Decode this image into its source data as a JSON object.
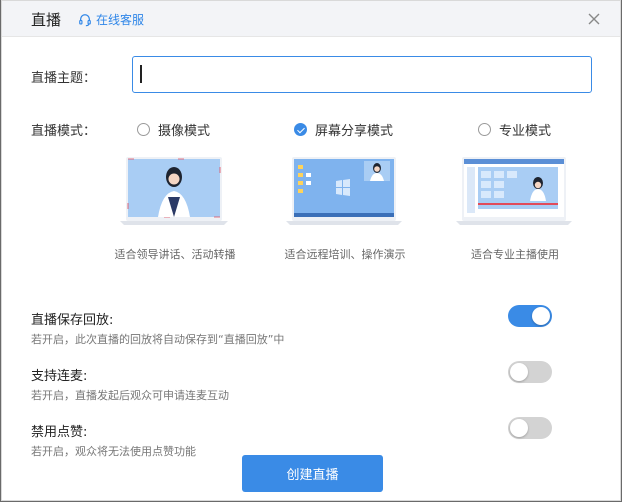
{
  "header": {
    "title": "直播",
    "support_label": "在线客服",
    "close_icon": "close-icon"
  },
  "form": {
    "topic_label": "直播主题：",
    "topic_value": "",
    "topic_placeholder": "",
    "mode_label": "直播模式："
  },
  "modes": [
    {
      "label": "摄像模式",
      "selected": false,
      "desc": "适合领导讲话、活动转播"
    },
    {
      "label": "屏幕分享模式",
      "selected": true,
      "desc": "适合远程培训、操作演示"
    },
    {
      "label": "专业模式",
      "selected": false,
      "desc": "适合专业主播使用"
    }
  ],
  "options": [
    {
      "title": "直播保存回放:",
      "desc": "若开启，此次直播的回放将自动保存到“直播回放”中",
      "enabled": true
    },
    {
      "title": "支持连麦:",
      "desc": "若开启，直播发起后观众可申请连麦互动",
      "enabled": false
    },
    {
      "title": "禁用点赞:",
      "desc": "若开启，观众将无法使用点赞功能",
      "enabled": false
    }
  ],
  "actions": {
    "create_label": "创建直播"
  },
  "colors": {
    "accent": "#3a8be6",
    "toggle_off": "#d3d3d3",
    "header_bg": "#f3f4f7"
  }
}
